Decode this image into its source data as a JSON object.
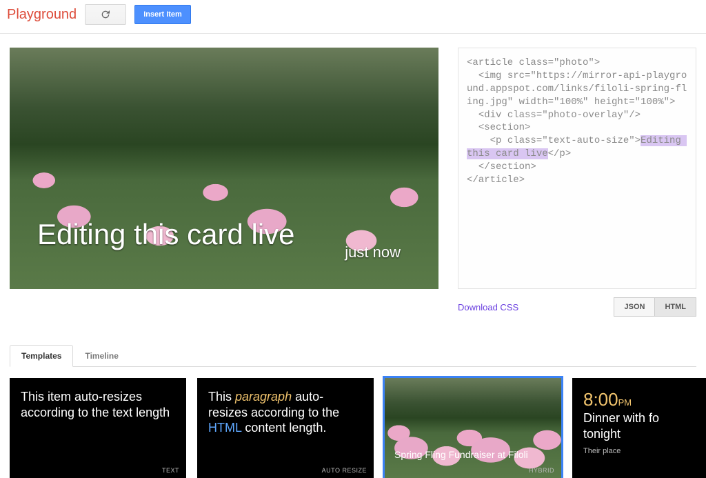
{
  "header": {
    "brand": "Playground",
    "insert_label": "Insert Item"
  },
  "preview": {
    "overlay_text": "Editing this card live",
    "timestamp": "just now"
  },
  "code": {
    "line1": "<article class=\"photo\">",
    "line2": "  <img src=\"https://mirror-api-playground.appspot.com/links/filoli-spring-fling.jpg\" width=\"100%\" height=\"100%\">",
    "line3": "  <div class=\"photo-overlay\"/>",
    "line4": "  <section>",
    "line5a": "    <p class=\"text-auto-size\">",
    "highlight": "Editing this card live",
    "line5b": "</p>",
    "line6": "  </section>",
    "line7": "</article>"
  },
  "side": {
    "download_css": "Download CSS",
    "json_btn": "JSON",
    "html_btn": "HTML"
  },
  "tabs": {
    "templates": "Templates",
    "timeline": "Timeline"
  },
  "templates": [
    {
      "text_a": "This item auto-resizes according to the text length",
      "badge": "TEXT"
    },
    {
      "text_b_1": "This ",
      "text_b_it": "paragraph",
      "text_b_2": " auto-resizes according to the ",
      "text_b_blue": "HTML",
      "text_b_3": " content length.",
      "badge": "AUTO RESIZE"
    },
    {
      "caption": "Spring Fling Fundraiser at Filoli",
      "badge": "HYBRID"
    },
    {
      "time": "8:00",
      "time_unit": "PM",
      "line1": "Dinner with fo",
      "line2": "tonight",
      "sub": "Their place"
    }
  ]
}
